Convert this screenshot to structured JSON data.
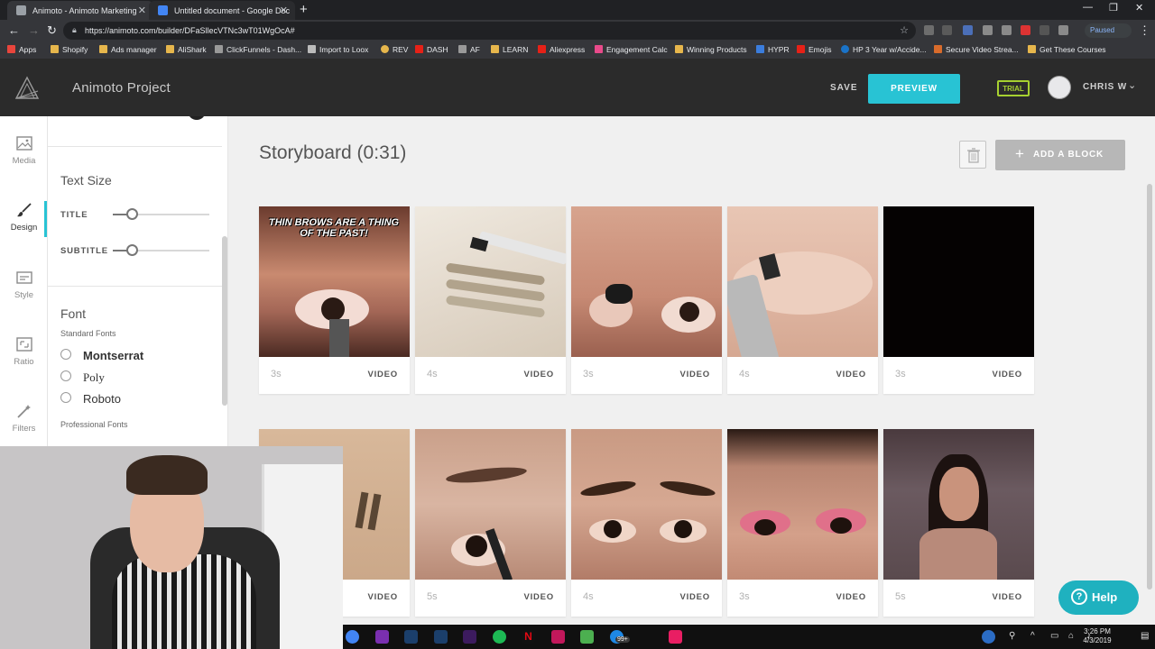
{
  "browser": {
    "tabs": [
      {
        "label": "Animoto - Animoto Marketing"
      },
      {
        "label": "Untitled document - Google Doc"
      }
    ],
    "url": "https://animoto.com/builder/DFaSllecVTNc3wT01WgOcA#",
    "paused_label": "Paused",
    "bookmarks": [
      "Apps",
      "Shopify",
      "Ads manager",
      "AliShark",
      "ClickFunnels - Dash...",
      "Import to Loox",
      "REV",
      "DASH",
      "AF",
      "LEARN",
      "Aliexpress",
      "Engagement Calc",
      "Winning Products",
      "HYPR",
      "Emojis",
      "HP 3 Year w/Accide...",
      "Secure Video Strea...",
      "Get These Courses"
    ]
  },
  "header": {
    "project_title": "Animoto Project",
    "save_label": "SAVE",
    "preview_label": "PREVIEW",
    "trial_label": "TRIAL",
    "user_name": "CHRIS W"
  },
  "rail": {
    "items": [
      {
        "label": "Media"
      },
      {
        "label": "Design"
      },
      {
        "label": "Style"
      },
      {
        "label": "Ratio"
      },
      {
        "label": "Filters"
      }
    ]
  },
  "panel": {
    "text_size_title": "Text Size",
    "sliders": [
      {
        "label": "TITLE",
        "level": 0.2
      },
      {
        "label": "SUBTITLE",
        "level": 0.2
      }
    ],
    "font_title": "Font",
    "standard_fonts_label": "Standard Fonts",
    "fonts": [
      "Montserrat",
      "Poly",
      "Roboto"
    ],
    "professional_fonts_label": "Professional Fonts"
  },
  "storyboard": {
    "title": "Storyboard (0:31)",
    "add_block_label": "ADD A BLOCK",
    "blocks": [
      {
        "duration": "3s",
        "type": "VIDEO",
        "overlay_text": "THIN BROWS ARE A THING OF THE PAST!"
      },
      {
        "duration": "4s",
        "type": "VIDEO",
        "overlay_text": ""
      },
      {
        "duration": "3s",
        "type": "VIDEO",
        "overlay_text": ""
      },
      {
        "duration": "4s",
        "type": "VIDEO",
        "overlay_text": ""
      },
      {
        "duration": "3s",
        "type": "VIDEO",
        "overlay_text": ""
      },
      {
        "duration": "",
        "type": "VIDEO",
        "overlay_text": ""
      },
      {
        "duration": "5s",
        "type": "VIDEO",
        "overlay_text": ""
      },
      {
        "duration": "4s",
        "type": "VIDEO",
        "overlay_text": ""
      },
      {
        "duration": "3s",
        "type": "VIDEO",
        "overlay_text": ""
      },
      {
        "duration": "5s",
        "type": "VIDEO",
        "overlay_text": ""
      }
    ]
  },
  "help_label": "Help",
  "taskbar": {
    "notification_badge": "99+",
    "time": "3:26 PM",
    "date": "4/3/2019"
  },
  "colors": {
    "accent": "#28c3d4",
    "trial": "#a7d130",
    "header_bg": "#2b2b2b",
    "help": "#1fb1bf"
  }
}
